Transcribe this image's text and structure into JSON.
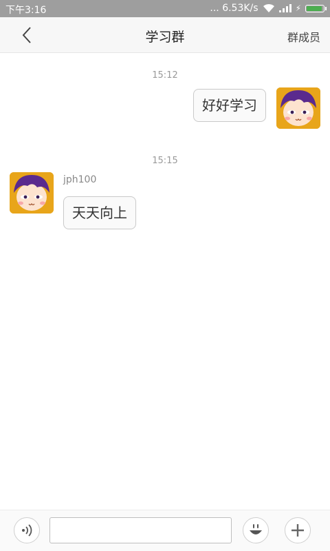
{
  "status_bar": {
    "time": "下午3:16",
    "network_speed": "... 6.53K/s",
    "battery_color": "#4caf50"
  },
  "header": {
    "title": "学习群",
    "members_label": "群成员"
  },
  "messages": [
    {
      "timestamp": "15:12",
      "direction": "outgoing",
      "sender": "",
      "text": "好好学习"
    },
    {
      "timestamp": "15:15",
      "direction": "incoming",
      "sender": "jph100",
      "text": "天天向上"
    }
  ],
  "input_bar": {
    "voice_icon": "voice-icon",
    "message_value": "",
    "emoji_icon": "emoji-icon",
    "add_icon": "plus-icon"
  }
}
